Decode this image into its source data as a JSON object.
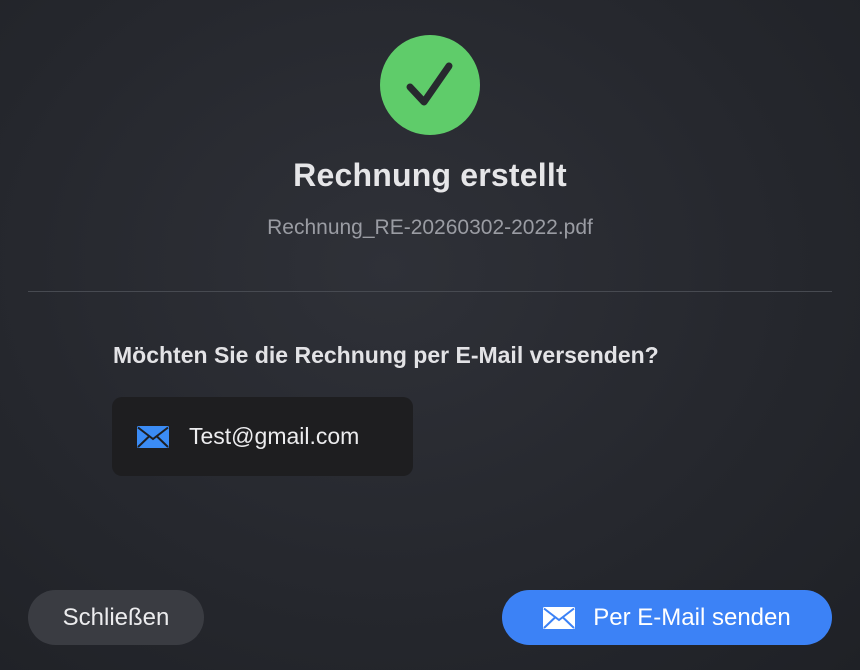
{
  "dialog": {
    "title": "Rechnung erstellt",
    "filename": "Rechnung_RE-20260302-2022.pdf",
    "question": "Möchten Sie die Rechnung per E-Mail versenden?",
    "recipient_email": "Test@gmail.com"
  },
  "icons": {
    "status": "checkmark-icon",
    "email": "envelope-icon"
  },
  "buttons": {
    "close_label": "Schließen",
    "send_label": "Per E-Mail senden"
  },
  "colors": {
    "success": "#5fcc6a",
    "accent": "#3c82f6",
    "envelope": "#3b8cf5"
  }
}
